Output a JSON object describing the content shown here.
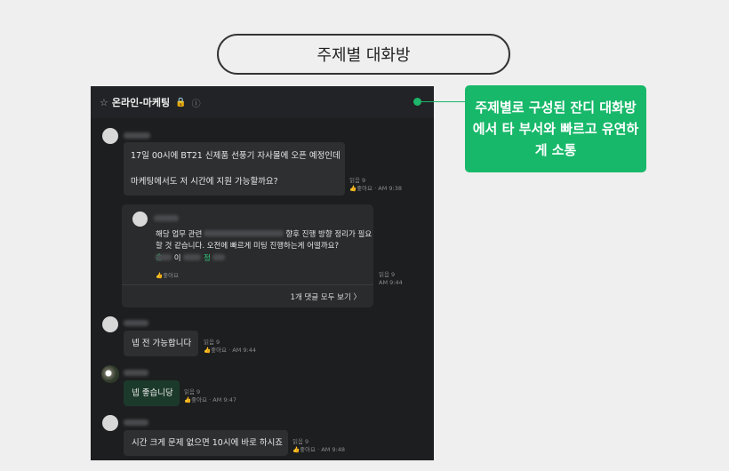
{
  "title": "주제별 대화방",
  "callout": "주제별로 구성된 잔디 대화방에서 타 부서와 빠르고 유연하게 소통",
  "room": {
    "star": "☆",
    "name": "온라인-마케팅",
    "lock_icon": "🔒",
    "info_icon": "ⓘ"
  },
  "messages": [
    {
      "text1": "17일 00시에 BT21 신제품 선풍기 자사몰에 오픈 예정인데",
      "text2": "마케팅에서도 저 시간에 지원 가능할까요?",
      "read": "읽음 9",
      "like": "좋아요",
      "time": "AM 9:38"
    },
    {
      "text": "넵 전 가능합니다",
      "read": "읽음 9",
      "like": "좋아요",
      "time": "AM 9:44"
    },
    {
      "text": "넵 좋습니당",
      "read": "읽음 9",
      "like": "좋아요",
      "time": "AM 9:47"
    },
    {
      "text": "시간 크게 문제 없으면 10시에 바로 하시죠",
      "read": "읽음 9",
      "like": "좋아요",
      "time": "AM 9:48"
    }
  ],
  "reply": {
    "line1a": "해당 업무 관련",
    "line1b": "향후 진행 방향 정리가 필요",
    "line2": "할 것 같습니다. 오전에 빠르게 미팅 진행하는게 어떨까요?",
    "mention1": "손",
    "mention2": "이",
    "mention3": "정",
    "like": "좋아요",
    "read": "읽음 9",
    "time": "AM 9:44",
    "more": "1개 댓글 모두 보기 〉"
  }
}
